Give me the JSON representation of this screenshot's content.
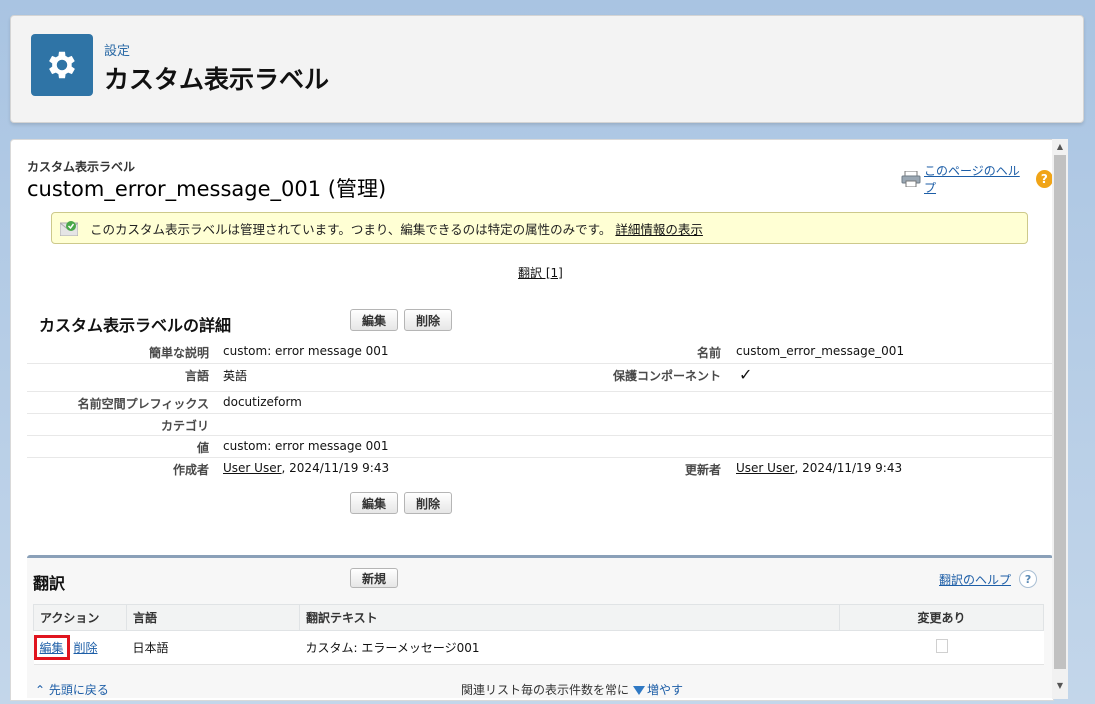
{
  "header": {
    "breadcrumb": "設定",
    "title": "カスタム表示ラベル"
  },
  "page": {
    "object_type": "カスタム表示ラベル",
    "title": "custom_error_message_001 (管理)",
    "help_link": "このページのヘルプ"
  },
  "info": {
    "message": "このカスタム表示ラベルは管理されています。つまり、編集できるのは特定の属性のみです。",
    "link": "詳細情報の表示"
  },
  "translation_link": "翻訳 [1]",
  "detail": {
    "section_title": "カスタム表示ラベルの詳細",
    "edit_button": "編集",
    "delete_button": "削除",
    "labels": {
      "short_desc": "簡単な説明",
      "name": "名前",
      "language": "言語",
      "protected": "保護コンポーネント",
      "namespace": "名前空間プレフィックス",
      "category": "カテゴリ",
      "value": "値",
      "created_by": "作成者",
      "modified_by": "更新者"
    },
    "values": {
      "short_desc": "custom: error message 001",
      "name": "custom_error_message_001",
      "language": "英語",
      "protected_check": "✓",
      "namespace": "docutizeform",
      "category": "",
      "value": "custom: error message 001",
      "created_by_user": "User User",
      "created_by_date": ", 2024/11/19 9:43",
      "modified_by_user": "User User",
      "modified_by_date": ", 2024/11/19 9:43"
    }
  },
  "translations": {
    "section_title": "翻訳",
    "new_button": "新規",
    "help_link": "翻訳のヘルプ",
    "columns": [
      "アクション",
      "言語",
      "翻訳テキスト",
      "変更あり"
    ],
    "rows": [
      {
        "edit": "編集",
        "delete": "削除",
        "language": "日本語",
        "text": "カスタム: エラーメッセージ001",
        "changed": false
      }
    ]
  },
  "footer": {
    "back_to_top": "先頭に戻る",
    "related_text": "関連リスト毎の表示件数を常に",
    "increase": "増やす"
  },
  "colors": {
    "accent": "#2f74a6",
    "link": "#1d5ea7",
    "highlight_border": "#e0141e"
  }
}
